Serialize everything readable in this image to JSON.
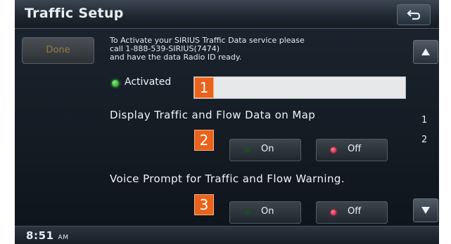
{
  "header": {
    "title": "Traffic Setup",
    "back_icon": "return-arrow-icon"
  },
  "done_label": "Done",
  "info_lines": [
    "To Activate your SIRIUS Traffic Data service please",
    "call 1-888-539-SIRIUS(7474)",
    "and have the data Radio ID ready."
  ],
  "status": {
    "label": "Activated",
    "value": ""
  },
  "markers": [
    "1",
    "2",
    "3"
  ],
  "display_setting": {
    "label": "Display Traffic and Flow Data on Map",
    "on_label": "On",
    "off_label": "Off",
    "selected": "Off"
  },
  "voice_setting": {
    "label": "Voice Prompt for Traffic and Flow Warning.",
    "on_label": "On",
    "off_label": "Off",
    "selected": "Off"
  },
  "pagination": {
    "pages": [
      "1",
      "2"
    ]
  },
  "clock": {
    "time": "8:51",
    "period": "AM"
  },
  "colors": {
    "accent_marker": "#e9631c",
    "selected_led": "#c3163a",
    "active_led": "#3ed13e"
  }
}
